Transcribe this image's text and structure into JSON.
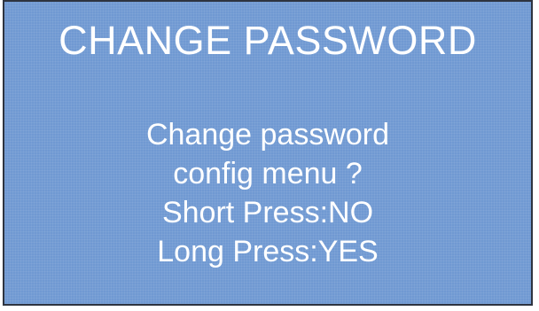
{
  "screen": {
    "title": "CHANGE PASSWORD",
    "prompt_line1": "Change password",
    "prompt_line2": "config menu ?",
    "short_press_label": "Short Press:NO",
    "long_press_label": "Long Press:YES",
    "background_color": "#7099d2",
    "text_color": "#ffffff"
  }
}
